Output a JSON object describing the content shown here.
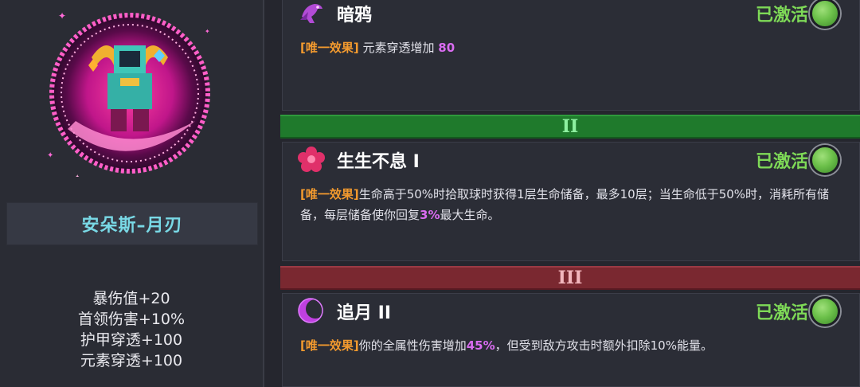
{
  "character": {
    "name": "安朵斯–月刃",
    "stats": [
      "暴伤值+20",
      "首领伤害+10%",
      "护甲穿透+100",
      "元素穿透+100"
    ]
  },
  "tiers": [
    {
      "numeral": "II",
      "color": "#1f7a2c"
    },
    {
      "numeral": "III",
      "color": "#7a2830"
    }
  ],
  "skills": [
    {
      "title": "暗鸦",
      "icon": "raven-icon",
      "status": "已激活",
      "tag": "[唯一效果]",
      "desc_a": "元素穿透增加",
      "hl1": "80",
      "desc_b": "",
      "hl2": "",
      "desc_c": ""
    },
    {
      "title": "生生不息 I",
      "icon": "flower-icon",
      "status": "已激活",
      "tag": "[唯一效果]",
      "desc_a": "生命高于50%时拾取球时获得1层生命储备，最多10层；当生命低于50%时，消耗所有储备，每层储备使你回复",
      "hl1": "3%",
      "desc_b": "最大生命。",
      "hl2": "",
      "desc_c": ""
    },
    {
      "title": "追月 II",
      "icon": "crescent-moon-icon",
      "status": "已激活",
      "tag": "[唯一效果]",
      "desc_a": "你的全属性伤害增加",
      "hl1": "45%",
      "desc_b": "，但受到敌方攻击时额外扣除10%能量。",
      "hl2": "",
      "desc_c": ""
    }
  ],
  "colors": {
    "active_status": "#7ed957",
    "effect_tag": "#f39a2e",
    "highlight": "#d96cf0",
    "name_text": "#79d9e6"
  }
}
